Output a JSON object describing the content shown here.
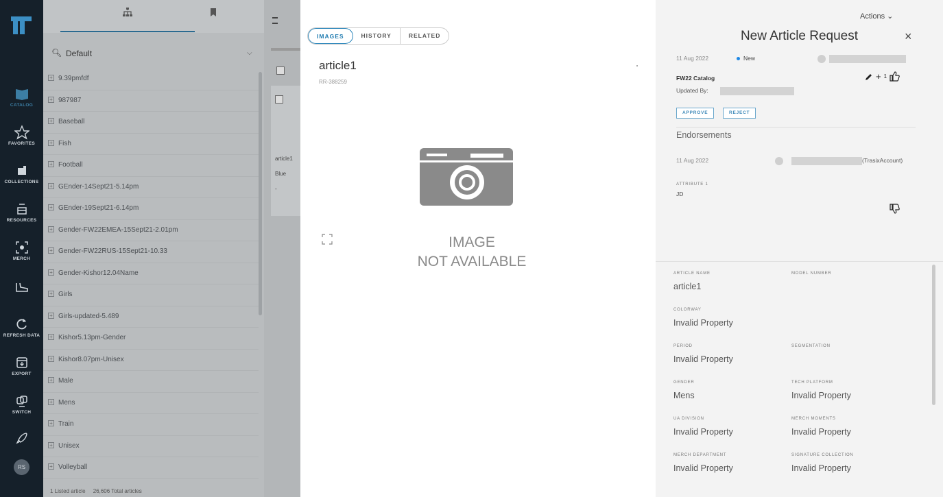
{
  "rail": {
    "items": [
      {
        "label": "CATALOG",
        "icon": "catalog-icon"
      },
      {
        "label": "FAVORITES",
        "icon": "star-icon"
      },
      {
        "label": "COLLECTIONS",
        "icon": "collections-icon"
      },
      {
        "label": "RESOURCES",
        "icon": "resources-icon"
      },
      {
        "label": "MERCH",
        "icon": "merch-icon"
      },
      {
        "label": "",
        "icon": "shoe-icon"
      },
      {
        "label": "REFRESH DATA",
        "icon": "refresh-icon"
      },
      {
        "label": "EXPORT",
        "icon": "export-icon"
      },
      {
        "label": "SWITCH",
        "icon": "switch-icon"
      },
      {
        "label": "",
        "icon": "rocket-icon"
      }
    ],
    "avatar": "RS",
    "accent": "#3c7ea4"
  },
  "tree": {
    "search_value": "Default",
    "items": [
      "9.39pmfdf",
      "987987",
      "Baseball",
      "Fish",
      "Football",
      "GEnder-14Sept21-5.14pm",
      "GEnder-19Sept21-6.14pm",
      "Gender-FW22EMEA-15Sept21-2.01pm",
      "Gender-FW22RUS-15Sept21-10.33",
      "Gender-Kishor12.04Name",
      "Girls",
      "Girls-updated-5.489",
      "Kishor5.13pm-Gender",
      "Kishor8.07pm-Unisex",
      "Male",
      "Mens",
      "Train",
      "Unisex",
      "Volleyball"
    ],
    "footer_listed": "1 Listed article",
    "footer_total": "26,606 Total articles"
  },
  "grid": {
    "card_name": "article1",
    "card_color": "Blue",
    "card_dash": "-"
  },
  "image_panel": {
    "tabs": [
      "IMAGES",
      "HISTORY",
      "RELATED"
    ],
    "active_tab": "IMAGES",
    "title": "article1",
    "subtitle": "RR-388259",
    "na_line1": "IMAGE",
    "na_line2": "NOT AVAILABLE"
  },
  "request": {
    "actions_label": "Actions",
    "title": "New Article Request",
    "close": "×",
    "date": "11 Aug 2022",
    "status": "New",
    "catalog": "FW22 Catalog",
    "updated_by": "Updated By:",
    "vote_count": "1",
    "approve": "APPROVE",
    "reject": "REJECT",
    "endorsements": "Endorsements",
    "endorse_date": "11 Aug 2022",
    "endorse_account": "(TrasixAccount)",
    "attribute_label": "ATTRIBUTE 1",
    "attribute_value": "JD",
    "status_color": "#1e88e5",
    "properties": [
      {
        "label": "ARTICLE NAME",
        "value": "article1"
      },
      {
        "label": "MODEL NUMBER",
        "value": ""
      },
      {
        "label": "COLORWAY",
        "value": "Invalid Property"
      },
      {
        "label": "",
        "value": ""
      },
      {
        "label": "PERIOD",
        "value": "Invalid Property"
      },
      {
        "label": "SEGMENTATION",
        "value": ""
      },
      {
        "label": "GENDER",
        "value": "Mens"
      },
      {
        "label": "TECH PLATFORM",
        "value": "Invalid Property"
      },
      {
        "label": "UA DIVISION",
        "value": "Invalid Property"
      },
      {
        "label": "MERCH MOMENTS",
        "value": "Invalid Property"
      },
      {
        "label": "MERCH DEPARTMENT",
        "value": "Invalid Property"
      },
      {
        "label": "SIGNATURE COLLECTION",
        "value": "Invalid Property"
      }
    ]
  }
}
